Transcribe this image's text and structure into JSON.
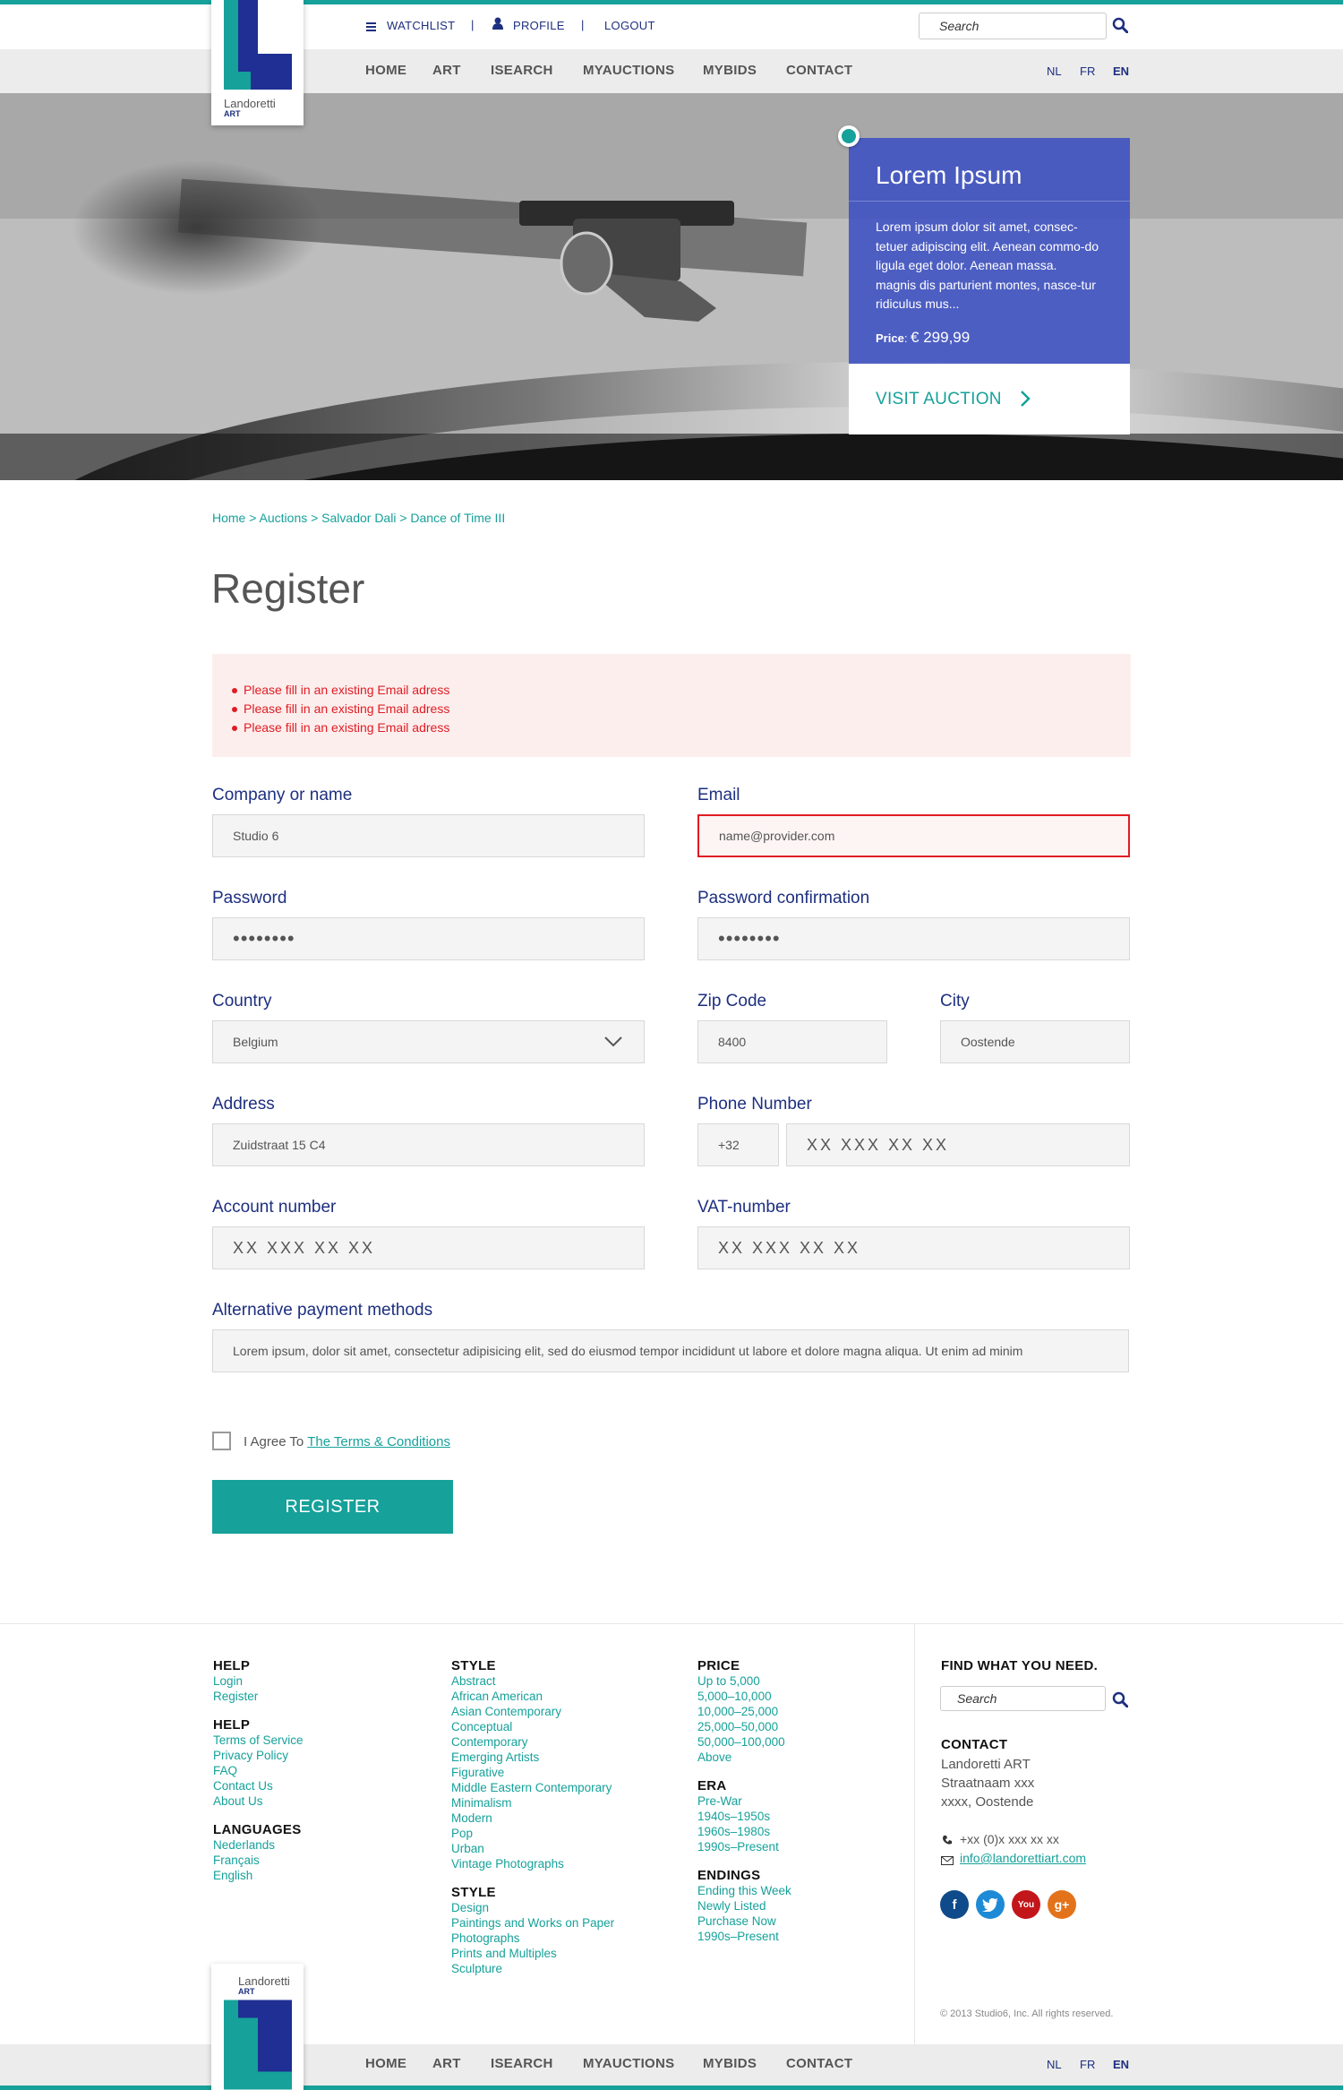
{
  "topbar": {
    "watchlist": "WATCHLIST",
    "profile": "PROFILE",
    "logout": "LOGOUT",
    "separator": "|",
    "search_placeholder": "Search"
  },
  "logo": {
    "brand": "Landoretti",
    "sub": "ART"
  },
  "nav": {
    "items": [
      "HOME",
      "ART",
      "ISEARCH",
      "MYAUCTIONS",
      "MYBIDS",
      "CONTACT"
    ],
    "languages": [
      "NL",
      "FR",
      "EN"
    ],
    "active_language": "EN"
  },
  "promo": {
    "title": "Lorem Ipsum",
    "text": "Lorem ipsum dolor sit amet, consec-tetuer adipiscing elit. Aenean commo-do ligula eget dolor. Aenean massa. magnis dis parturient montes, nasce-tur ridiculus mus...",
    "price_label": "Price",
    "price_value": "€ 299,99",
    "button": "VISIT AUCTION"
  },
  "breadcrumb": "Home > Auctions > Salvador Dali > Dance of Time III",
  "page_title": "Register",
  "errors": [
    "Please fill in an existing Email adress",
    "Please fill in an existing Email adress",
    "Please fill in an existing Email adress"
  ],
  "form": {
    "company_label": "Company or name",
    "company_value": "Studio 6",
    "email_label": "Email",
    "email_value": "name@provider.com",
    "password_label": "Password",
    "password_value": "••••••••",
    "password_conf_label": "Password confirmation",
    "password_conf_value": "••••••••",
    "country_label": "Country",
    "country_value": "Belgium",
    "zip_label": "Zip Code",
    "zip_value": "8400",
    "city_label": "City",
    "city_value": "Oostende",
    "address_label": "Address",
    "address_value": "Zuidstraat 15 C4",
    "phone_label": "Phone Number",
    "phone_prefix": "+32",
    "phone_placeholder": "XX XXX XX XX",
    "account_label": "Account number",
    "account_placeholder": "XX XXX XX XX",
    "vat_label": "VAT-number",
    "vat_placeholder": "XX XXX XX XX",
    "alt_pay_label": "Alternative payment methods",
    "alt_pay_value": "Lorem ipsum, dolor sit amet, consectetur adipisicing elit, sed do eiusmod tempor incididunt ut labore et dolore magna aliqua. Ut enim ad minim",
    "terms_prefix": "I Agree To",
    "terms_link": "The Terms & Conditions",
    "submit": "REGISTER"
  },
  "footer": {
    "col1": [
      {
        "heading": "HELP",
        "links": [
          "Login",
          "Register"
        ]
      },
      {
        "heading": "HELP",
        "links": [
          "Terms of Service",
          "Privacy Policy",
          "FAQ",
          "Contact Us",
          "About Us"
        ]
      },
      {
        "heading": "LANGUAGES",
        "links": [
          "Nederlands",
          "Français",
          "English"
        ]
      }
    ],
    "col2": [
      {
        "heading": "STYLE",
        "links": [
          "Abstract",
          "African American",
          "Asian Contemporary",
          "Conceptual",
          "Contemporary",
          "Emerging Artists",
          "Figurative",
          "Middle Eastern Contemporary",
          "Minimalism",
          "Modern",
          "Pop",
          "Urban",
          "Vintage Photographs"
        ]
      },
      {
        "heading": "STYLE",
        "links": [
          "Design",
          "Paintings and Works on Paper",
          "Photographs",
          "Prints and Multiples",
          "Sculpture"
        ]
      }
    ],
    "col3": [
      {
        "heading": "PRICE",
        "links": [
          "Up to 5,000",
          "5,000–10,000",
          "10,000–25,000",
          "25,000–50,000",
          "50,000–100,000",
          "Above"
        ]
      },
      {
        "heading": "ERA",
        "links": [
          "Pre-War",
          "1940s–1950s",
          "1960s–1980s",
          "1990s–Present"
        ]
      },
      {
        "heading": "ENDINGS",
        "links": [
          "Ending this Week",
          "Newly Listed",
          "Purchase Now",
          "1990s–Present"
        ]
      }
    ],
    "find_heading": "FIND WHAT YOU NEED.",
    "search_placeholder": "Search",
    "contact_heading": "CONTACT",
    "contact_lines": [
      "Landoretti ART",
      "Straatnaam xxx",
      "xxxx, Oostende"
    ],
    "phone": "+xx (0)x xxx xx xx",
    "email": "info@landorettiart.com",
    "social": [
      "facebook-icon",
      "twitter-icon",
      "youtube-icon",
      "googleplus-icon"
    ],
    "copyright": "© 2013 Studio6, Inc. All rights reserved."
  },
  "colors": {
    "teal": "#16a19a",
    "navy": "#1d2f7f",
    "promo": "#3a4ec3",
    "error": "#e01c22"
  }
}
